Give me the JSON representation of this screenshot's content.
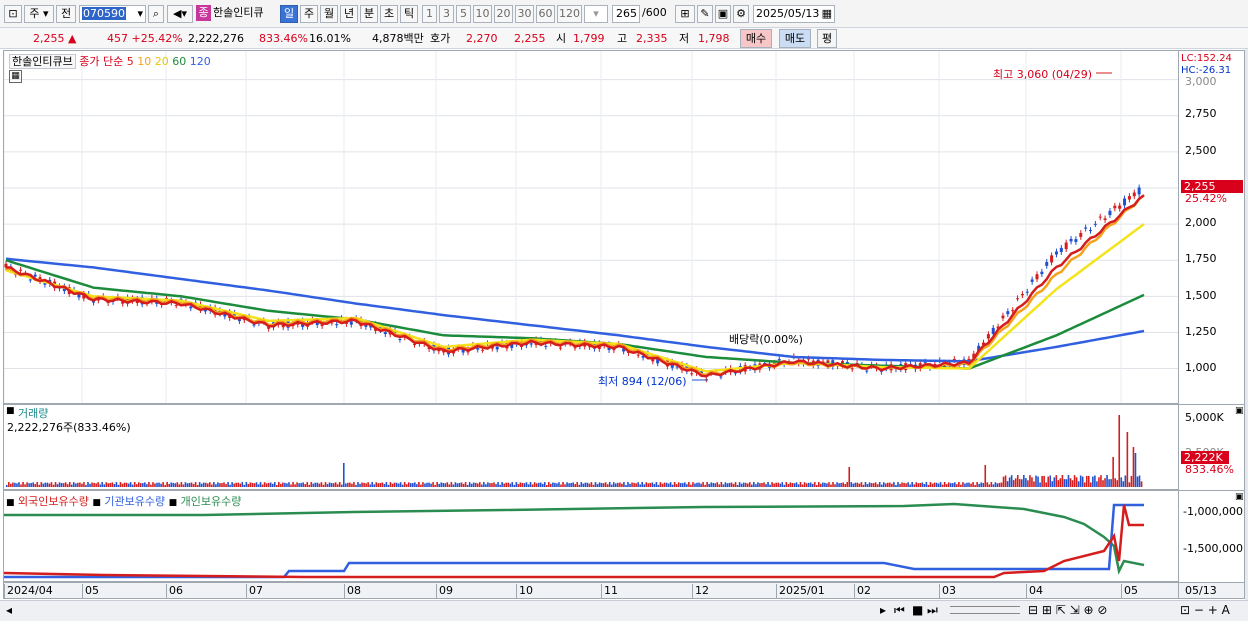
{
  "toolbar": {
    "period": "주",
    "prefix": "전",
    "code": "070590",
    "stock_badge": "종",
    "stock_name": "한솔인티큐",
    "periods": [
      "일",
      "주",
      "월",
      "년",
      "분",
      "초",
      "틱"
    ],
    "active_period": "일",
    "intervals": [
      "1",
      "3",
      "5",
      "10",
      "20",
      "30",
      "60",
      "120"
    ],
    "count": "265",
    "total": "/600",
    "date": "2025/05/13"
  },
  "quote": {
    "price": "2,255",
    "change": "457",
    "change_pct": "+25.42%",
    "volume": "2,222,276",
    "volume_ratio": "833.46%",
    "turnover": "16.01%",
    "amount": "4,878백만",
    "bid_label": "호가",
    "bid1": "2,270",
    "bid2": "2,255",
    "open_label": "시",
    "open": "1,799",
    "high_label": "고",
    "high": "2,335",
    "low_label": "저",
    "low": "1,798",
    "buy": "매수",
    "sell": "매도",
    "eval": "평"
  },
  "price_pane": {
    "name": "한솔인티큐브",
    "ma_label": "종가 단순",
    "ma_periods": [
      "5",
      "10",
      "20",
      "60",
      "120"
    ],
    "ma_colors": [
      "#d61d1d",
      "#f4a21b",
      "#f4e21b",
      "#1c8c3c",
      "#3060e0"
    ],
    "lc": "LC:152.24",
    "hc": "HC:-26.31",
    "y_ticks": [
      "2,750",
      "2,500",
      "2,250",
      "2,000",
      "1,750",
      "1,500",
      "1,250",
      "1,000"
    ],
    "top_tick": "3,000",
    "high_note": "최고 3,060 (04/29)",
    "low_note": "최저 894 (12/06)",
    "dividend_note": "배당락(0.00%)",
    "last_price": "2,255",
    "last_pct": "25.42%"
  },
  "volume_pane": {
    "title": "거래량",
    "value": "2,222,276주(833.46%)",
    "y_ticks": [
      "5,000K",
      "2,500K"
    ],
    "last": "2,222K",
    "last_pct": "833.46%"
  },
  "holding_pane": {
    "legend": [
      "외국인보유수량",
      "기관보유수량",
      "개인보유수량"
    ],
    "legend_colors": [
      "#d61d1d",
      "#3060e0",
      "#2a8c50"
    ],
    "y_ticks": [
      "-1,000,000",
      "-1,500,000"
    ]
  },
  "x_axis": [
    "2024/04",
    "05",
    "06",
    "07",
    "08",
    "09",
    "10",
    "11",
    "12",
    "2025/01",
    "02",
    "03",
    "04",
    "05"
  ],
  "x_axis_right": "05/13",
  "chart_data": {
    "type": "line",
    "title": "한솔인티큐브",
    "x_range": [
      "2024/04",
      "2025/05/13"
    ],
    "ylim": [
      900,
      3060
    ],
    "series": [
      {
        "name": "5",
        "values": [
          1700,
          1480,
          1450,
          1300,
          1330,
          1120,
          1180,
          1150,
          950,
          1050,
          1000,
          1040,
          1700,
          2200
        ]
      },
      {
        "name": "10",
        "values": [
          1690,
          1490,
          1460,
          1310,
          1340,
          1130,
          1190,
          1160,
          960,
          1040,
          1000,
          1030,
          1650,
          2200
        ]
      },
      {
        "name": "20",
        "values": [
          1680,
          1500,
          1470,
          1330,
          1350,
          1150,
          1200,
          1170,
          980,
          1040,
          1010,
          1000,
          1550,
          2000
        ]
      },
      {
        "name": "60",
        "values": [
          1750,
          1560,
          1500,
          1400,
          1340,
          1230,
          1210,
          1170,
          1080,
          1040,
          1020,
          1000,
          1230,
          1510
        ]
      },
      {
        "name": "120",
        "values": [
          1760,
          1700,
          1620,
          1540,
          1450,
          1370,
          1300,
          1230,
          1150,
          1080,
          1060,
          1050,
          1150,
          1260
        ]
      }
    ],
    "close": [
      1700,
      1480,
      1460,
      1300,
      1330,
      1120,
      1180,
      1150,
      950,
      1060,
      1000,
      1050,
      1800,
      2255
    ]
  }
}
